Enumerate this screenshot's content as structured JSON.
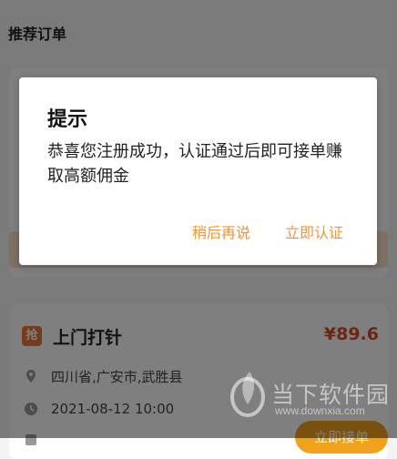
{
  "header": {
    "section_title": "推荐订单"
  },
  "order": {
    "badge": "抢",
    "title": "上门打针",
    "price": "¥89.6",
    "location": "四川省,广安市,武胜县",
    "datetime": "2021-08-12  10:00",
    "accept_label": "立即接单"
  },
  "dialog": {
    "title": "提示",
    "message": "恭喜您注册成功，认证通过后即可接单赚取高额佣金",
    "later_label": "稍后再说",
    "verify_label": "立即认证"
  },
  "watermark": {
    "brand": "当下软件园",
    "url": "www.downxia.com"
  },
  "colors": {
    "accent": "#f0953a",
    "price": "#d84b2a",
    "button": "#f0a21c",
    "badge": "#e8783a"
  },
  "icons": [
    "location-pin-icon",
    "clock-icon",
    "tag-icon",
    "watermark-logo-icon"
  ]
}
